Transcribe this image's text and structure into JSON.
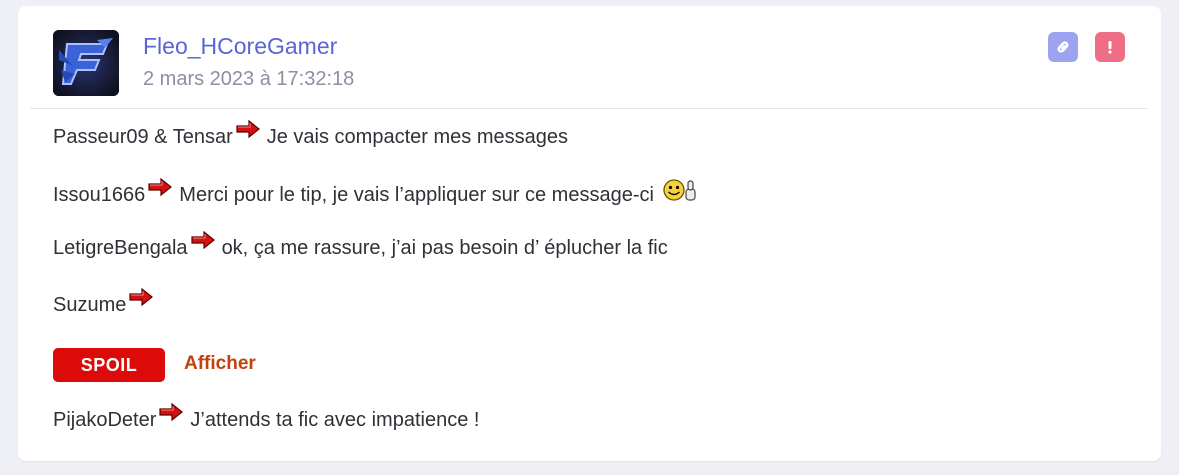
{
  "post": {
    "username": "Fleo_HCoreGamer",
    "date": "2 mars 2023 à 17:32:18",
    "actions": {
      "link_icon": "link-icon",
      "report_icon": "exclamation-icon",
      "link_color": "#9ca4f0",
      "report_color": "#ee6e86"
    },
    "lines": [
      {
        "name": "Passeur09 & Tensar",
        "text": "Je vais compacter mes messages"
      },
      {
        "name": "Issou1666",
        "text": "Merci pour le tip, je vais l’appliquer sur ce message-ci"
      },
      {
        "name": "LetigreBengala",
        "text": "ok, ça me rassure, j’ai pas besoin d’ éplucher la fic"
      },
      {
        "name": "Suzume",
        "text": ""
      },
      {
        "name": "PijakoDeter",
        "text": "J’attends ta fic avec impatience !"
      }
    ],
    "spoil": {
      "label": "SPOIL",
      "show_label": "Afficher"
    }
  },
  "colors": {
    "username": "#5a64d6",
    "spoil_bg": "#dd0a0a",
    "spoil_show": "#c2410c",
    "background": "#eef0f6"
  }
}
